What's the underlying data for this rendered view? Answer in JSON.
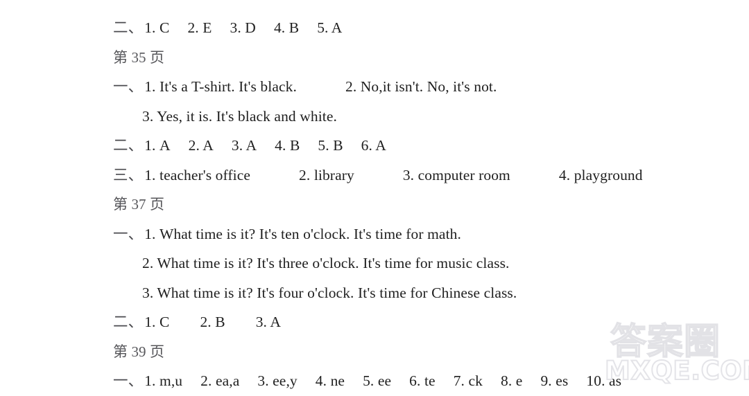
{
  "document": {
    "type": "answer-key",
    "background_color": "#ffffff",
    "text_color": "#1f1f1f"
  },
  "lines": [
    {
      "id": "line-1",
      "kind": "answer-row",
      "enumerator": "二、",
      "indent": false,
      "items": [
        "1. C",
        "2. E",
        "3. D",
        "4. B",
        "5. A"
      ]
    },
    {
      "id": "line-2",
      "kind": "page-heading",
      "text": "第 35 页"
    },
    {
      "id": "line-3",
      "kind": "answer-row",
      "enumerator": "一、",
      "indent": false,
      "items": [
        "1. It's a T-shirt. It's black.",
        "2. No,it isn't. No, it's not."
      ]
    },
    {
      "id": "line-4",
      "kind": "answer-row",
      "enumerator": "",
      "indent": true,
      "items": [
        "3. Yes, it is. It's black and white."
      ]
    },
    {
      "id": "line-5",
      "kind": "answer-row",
      "enumerator": "二、",
      "indent": false,
      "items": [
        "1. A",
        "2. A",
        "3. A",
        "4. B",
        "5. B",
        "6. A"
      ]
    },
    {
      "id": "line-6",
      "kind": "answer-row",
      "enumerator": "三、",
      "indent": false,
      "items": [
        "1. teacher's office",
        "2. library",
        "3. computer room",
        "4. playground"
      ]
    },
    {
      "id": "line-7",
      "kind": "page-heading",
      "text": "第 37 页"
    },
    {
      "id": "line-8",
      "kind": "answer-row",
      "enumerator": "一、",
      "indent": false,
      "items": [
        "1. What time is it? It's ten o'clock. It's time for math."
      ]
    },
    {
      "id": "line-9",
      "kind": "answer-row",
      "enumerator": "",
      "indent": true,
      "items": [
        "2. What time is it? It's three o'clock. It's time for music class."
      ]
    },
    {
      "id": "line-10",
      "kind": "answer-row",
      "enumerator": "",
      "indent": true,
      "items": [
        "3. What time is it? It's four o'clock. It's time for Chinese class."
      ]
    },
    {
      "id": "line-11",
      "kind": "answer-row",
      "enumerator": "二、",
      "indent": false,
      "items": [
        "1. C",
        "2. B",
        "3. A"
      ]
    },
    {
      "id": "line-12",
      "kind": "page-heading",
      "text": "第 39 页"
    },
    {
      "id": "line-13",
      "kind": "answer-row",
      "enumerator": "一、",
      "indent": false,
      "items": [
        "1. m,u",
        "2. ea,a",
        "3. ee,y",
        "4. ne",
        "5. ee",
        "6. te",
        "7. ck",
        "8. e",
        "9. es",
        "10. as"
      ]
    }
  ],
  "watermark": {
    "chinese_text": "答案圈",
    "site_text": "MXQE.COM",
    "color": "#e3e3e7"
  }
}
